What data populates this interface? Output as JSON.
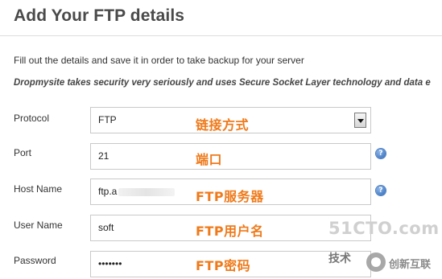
{
  "page": {
    "title": "Add Your FTP details",
    "description": "Fill out the details and save it in order to take backup for your server",
    "security_note": "Dropmysite takes security very seriously and uses Secure Socket Layer technology and data e"
  },
  "form": {
    "protocol": {
      "label": "Protocol",
      "value": "FTP",
      "annotation": "链接方式"
    },
    "port": {
      "label": "Port",
      "value": "21",
      "annotation": "端口"
    },
    "host": {
      "label": "Host Name",
      "value": "ftp.a",
      "annotation": "FTP服务器"
    },
    "user": {
      "label": "User Name",
      "value": "soft",
      "annotation": "FTP用户名"
    },
    "password": {
      "label": "Password",
      "value": "•••••••",
      "annotation": "FTP密码"
    }
  },
  "help_icon_glyph": "?",
  "watermark": {
    "main": "51CTO.com",
    "sub": "技术",
    "logo_text": "创新互联"
  },
  "colors": {
    "annotation": "#ef7a1b",
    "help_icon": "#2c67b6",
    "title": "#4a4a4a"
  },
  "icons": [
    "help-icon",
    "dropdown-arrow-icon",
    "watermark-logo-icon"
  ]
}
